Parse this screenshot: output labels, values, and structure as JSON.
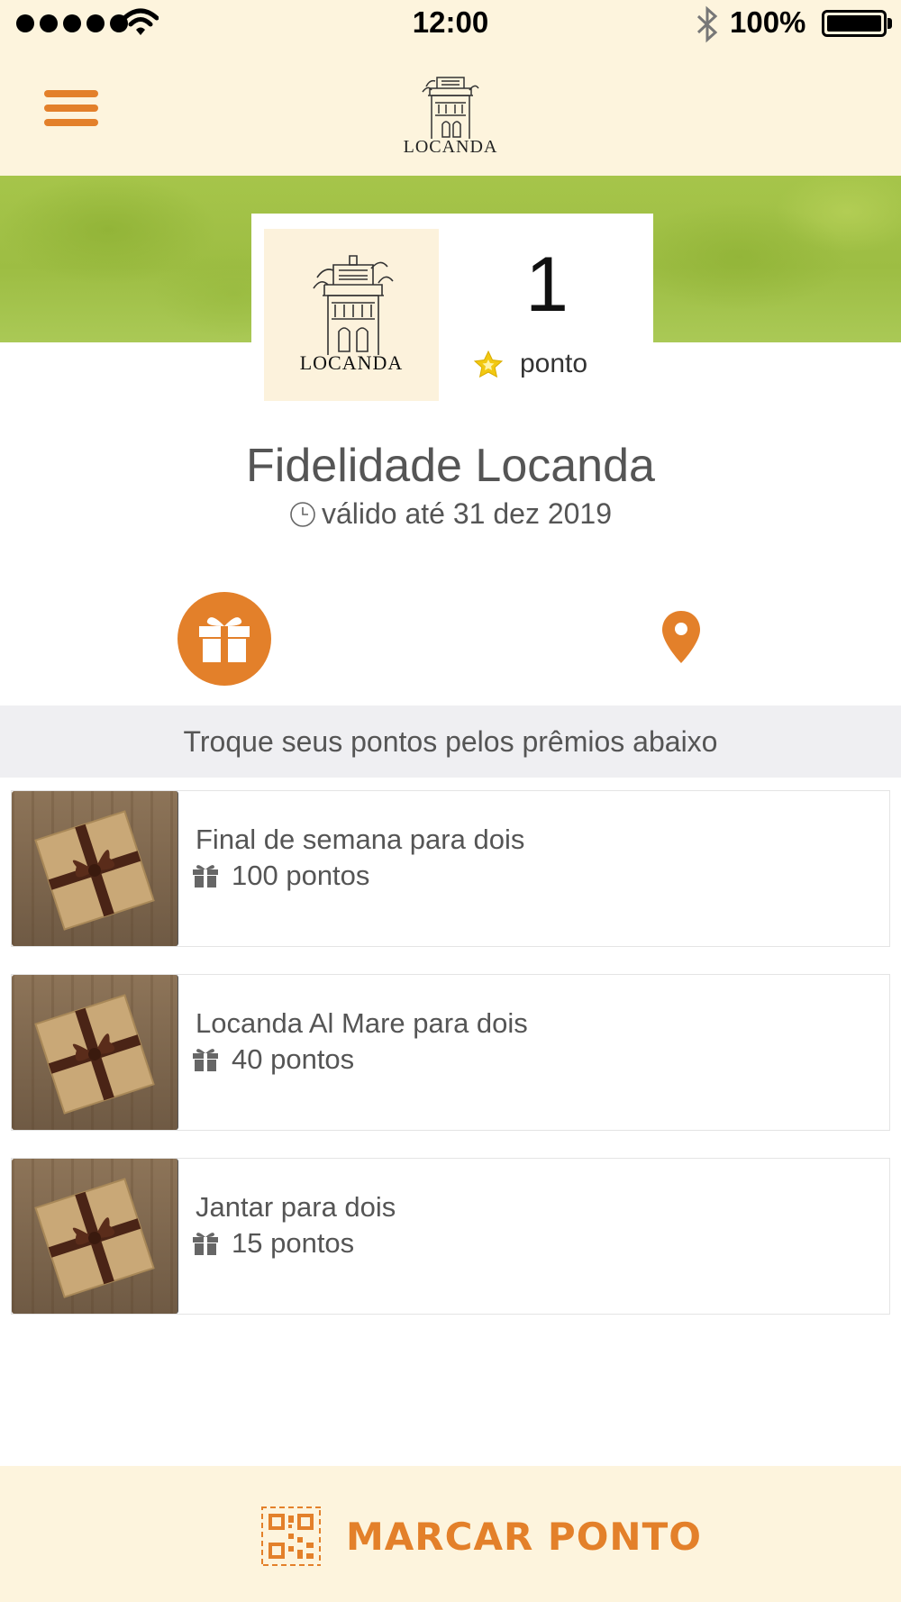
{
  "status_bar": {
    "time": "12:00",
    "battery": "100%",
    "icons": [
      "signal-dots",
      "wifi-icon",
      "bluetooth-icon",
      "battery-icon"
    ]
  },
  "header": {
    "menu_icon": "hamburger-menu-icon",
    "logo_text": "LOCANDA"
  },
  "card": {
    "logo_text": "LOCANDA",
    "points_value": "1",
    "points_label": "ponto",
    "star_icon": "star-icon"
  },
  "program": {
    "title": "Fidelidade Locanda",
    "validity": "válido até 31 dez 2019",
    "clock_icon": "clock-icon"
  },
  "tabs": {
    "gifts_icon": "gift-icon",
    "location_icon": "map-pin-icon"
  },
  "rewards_section": {
    "header": "Troque seus pontos pelos prêmios abaixo",
    "items": [
      {
        "title": "Final de semana para dois",
        "cost": "100 pontos"
      },
      {
        "title": "Locanda Al Mare para dois",
        "cost": "40 pontos"
      },
      {
        "title": "Jantar para dois",
        "cost": "15 pontos"
      }
    ]
  },
  "action": {
    "label": "MARCAR PONTO",
    "icon": "qr-code-icon"
  },
  "colors": {
    "accent": "#e3802a",
    "cream": "#fdf4dd",
    "banner_green": "#a6c54a",
    "star_yellow": "#f2c811",
    "section_gray": "#efeff2"
  }
}
